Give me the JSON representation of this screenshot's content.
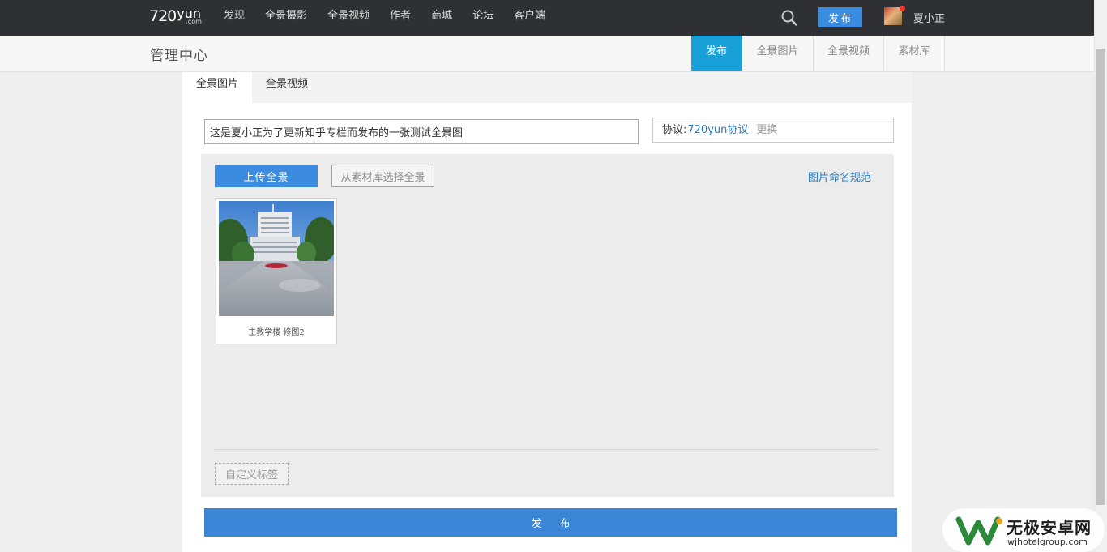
{
  "header": {
    "logo": {
      "main": "720",
      "suffix": "yun",
      "sub": ".com"
    },
    "nav": [
      "发现",
      "全景摄影",
      "全景视频",
      "作者",
      "商城",
      "论坛",
      "客户端"
    ],
    "publish_label": "发布",
    "username": "夏小正",
    "icons": {
      "search": "search-icon",
      "avatar": "user-avatar"
    }
  },
  "subheader": {
    "title": "管理中心",
    "tabs": [
      {
        "label": "发布",
        "active": true
      },
      {
        "label": "全景图片",
        "active": false
      },
      {
        "label": "全景视频",
        "active": false
      },
      {
        "label": "素材库",
        "active": false
      }
    ]
  },
  "panel": {
    "tabs": [
      {
        "label": "全景图片",
        "active": true
      },
      {
        "label": "全景视频",
        "active": false
      }
    ],
    "title_value": "这是夏小正为了更新知乎专栏而发布的一张测试全景图",
    "protocol": {
      "label": "协议:",
      "link": "720yun协议",
      "change": "更换"
    },
    "upload_label": "上传全景",
    "library_label": "从素材库选择全景",
    "naming_link": "图片命名规范",
    "images": [
      {
        "caption": "主教学楼 修图2"
      }
    ],
    "custom_tag_label": "自定义标签",
    "publish_label": "发 布"
  },
  "watermark": {
    "title": "无极安卓网",
    "url": "wjhotelgroup.com"
  },
  "colors": {
    "topbar": "#2e3033",
    "accent": "#3b8be0",
    "active_tab": "#1aa0d8",
    "link": "#2a7bc4"
  }
}
